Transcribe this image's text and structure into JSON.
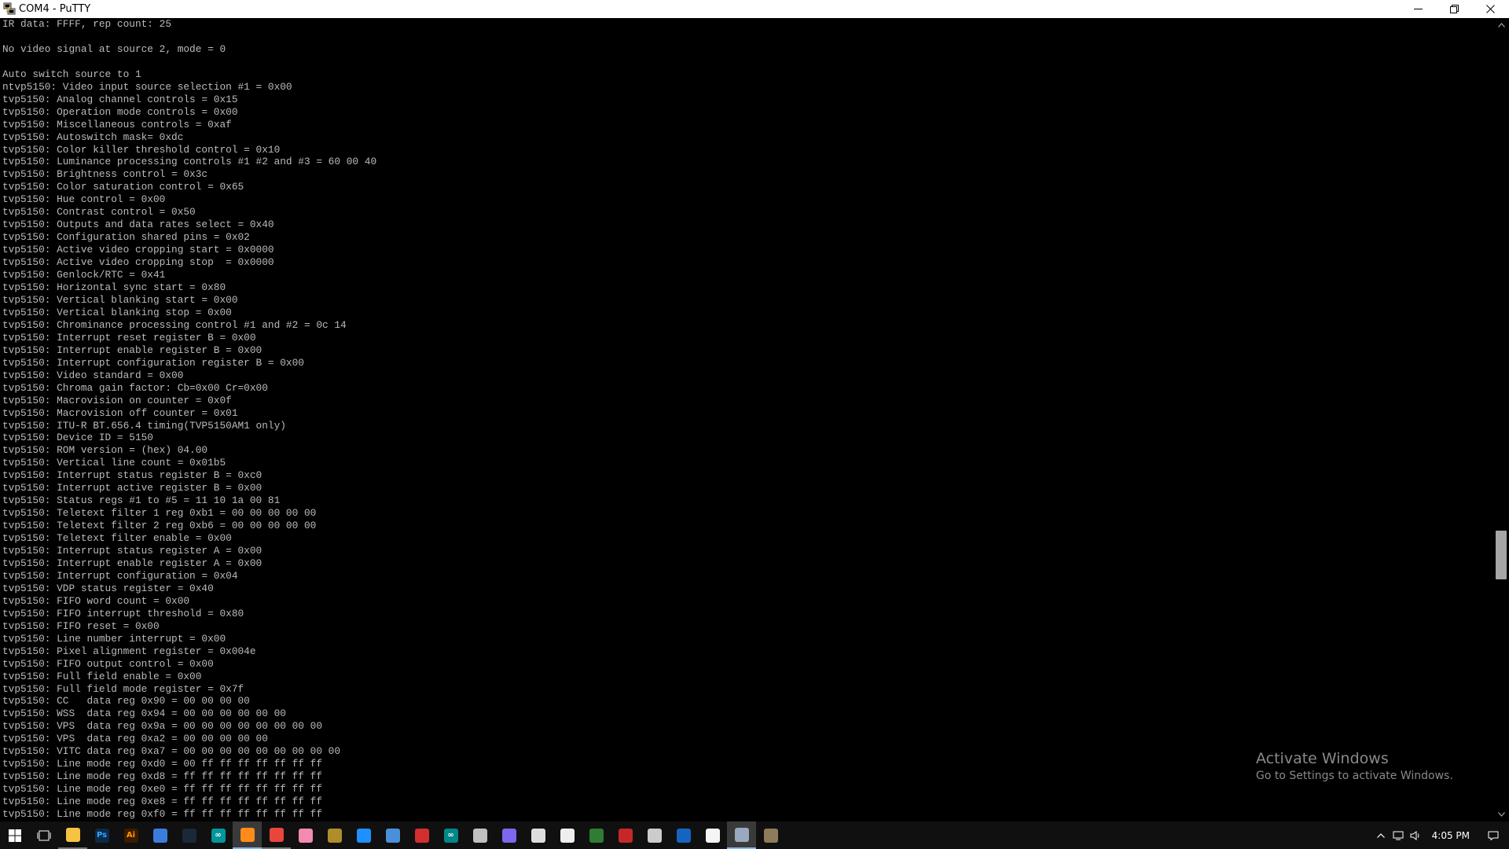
{
  "window": {
    "title": "COM4 - PuTTY"
  },
  "terminal": {
    "lines": [
      "IR data: FFFF, rep count: 25",
      "",
      "No video signal at source 2, mode = 0",
      "",
      "Auto switch source to 1",
      "ntvp5150: Video input source selection #1 = 0x00",
      "tvp5150: Analog channel controls = 0x15",
      "tvp5150: Operation mode controls = 0x00",
      "tvp5150: Miscellaneous controls = 0xaf",
      "tvp5150: Autoswitch mask= 0xdc",
      "tvp5150: Color killer threshold control = 0x10",
      "tvp5150: Luminance processing controls #1 #2 and #3 = 60 00 40",
      "tvp5150: Brightness control = 0x3c",
      "tvp5150: Color saturation control = 0x65",
      "tvp5150: Hue control = 0x00",
      "tvp5150: Contrast control = 0x50",
      "tvp5150: Outputs and data rates select = 0x40",
      "tvp5150: Configuration shared pins = 0x02",
      "tvp5150: Active video cropping start = 0x0000",
      "tvp5150: Active video cropping stop  = 0x0000",
      "tvp5150: Genlock/RTC = 0x41",
      "tvp5150: Horizontal sync start = 0x80",
      "tvp5150: Vertical blanking start = 0x00",
      "tvp5150: Vertical blanking stop = 0x00",
      "tvp5150: Chrominance processing control #1 and #2 = 0c 14",
      "tvp5150: Interrupt reset register B = 0x00",
      "tvp5150: Interrupt enable register B = 0x00",
      "tvp5150: Interrupt configuration register B = 0x00",
      "tvp5150: Video standard = 0x00",
      "tvp5150: Chroma gain factor: Cb=0x00 Cr=0x00",
      "tvp5150: Macrovision on counter = 0x0f",
      "tvp5150: Macrovision off counter = 0x01",
      "tvp5150: ITU-R BT.656.4 timing(TVP5150AM1 only)",
      "tvp5150: Device ID = 5150",
      "tvp5150: ROM version = (hex) 04.00",
      "tvp5150: Vertical line count = 0x01b5",
      "tvp5150: Interrupt status register B = 0xc0",
      "tvp5150: Interrupt active register B = 0x00",
      "tvp5150: Status regs #1 to #5 = 11 10 1a 00 81",
      "tvp5150: Teletext filter 1 reg 0xb1 = 00 00 00 00 00",
      "tvp5150: Teletext filter 2 reg 0xb6 = 00 00 00 00 00",
      "tvp5150: Teletext filter enable = 0x00",
      "tvp5150: Interrupt status register A = 0x00",
      "tvp5150: Interrupt enable register A = 0x00",
      "tvp5150: Interrupt configuration = 0x04",
      "tvp5150: VDP status register = 0x40",
      "tvp5150: FIFO word count = 0x00",
      "tvp5150: FIFO interrupt threshold = 0x80",
      "tvp5150: FIFO reset = 0x00",
      "tvp5150: Line number interrupt = 0x00",
      "tvp5150: Pixel alignment register = 0x004e",
      "tvp5150: FIFO output control = 0x00",
      "tvp5150: Full field enable = 0x00",
      "tvp5150: Full field mode register = 0x7f",
      "tvp5150: CC   data reg 0x90 = 00 00 00 00",
      "tvp5150: WSS  data reg 0x94 = 00 00 00 00 00 00",
      "tvp5150: VPS  data reg 0x9a = 00 00 00 00 00 00 00 00",
      "tvp5150: VPS  data reg 0xa2 = 00 00 00 00 00",
      "tvp5150: VITC data reg 0xa7 = 00 00 00 00 00 00 00 00 00",
      "tvp5150: Line mode reg 0xd0 = 00 ff ff ff ff ff ff ff",
      "tvp5150: Line mode reg 0xd8 = ff ff ff ff ff ff ff ff",
      "tvp5150: Line mode reg 0xe0 = ff ff ff ff ff ff ff ff",
      "tvp5150: Line mode reg 0xe8 = ff ff ff ff ff ff ff ff",
      "tvp5150: Line mode reg 0xf0 = ff ff ff ff ff ff ff ff"
    ],
    "text_color": "#bbbbbb",
    "background_color": "#000000"
  },
  "scrollbar": {
    "thumb_start": 0.643,
    "thumb_fraction": 0.063
  },
  "watermark": {
    "title": "Activate Windows",
    "subtitle": "Go to Settings to activate Windows."
  },
  "taskbar": {
    "apps": [
      {
        "icon": "windows-start-icon",
        "glyph": "",
        "color": "#ffffff",
        "state": "none"
      },
      {
        "icon": "task-view-icon",
        "glyph": "",
        "color": "#ffffff",
        "state": "none"
      },
      {
        "icon": "file-explorer-icon",
        "glyph": "",
        "color": "#f5c342",
        "state": "running"
      },
      {
        "icon": "photoshop-icon",
        "glyph": "Ps",
        "color": "#0b2a4a",
        "state": "none"
      },
      {
        "icon": "illustrator-icon",
        "glyph": "Ai",
        "color": "#3a1c00",
        "state": "none"
      },
      {
        "icon": "network-tool-icon",
        "glyph": "",
        "color": "#3b7ddd",
        "state": "none"
      },
      {
        "icon": "steam-icon",
        "glyph": "",
        "color": "#1b2838",
        "state": "none"
      },
      {
        "icon": "arduino-icon",
        "glyph": "∞",
        "color": "#00979c",
        "state": "none"
      },
      {
        "icon": "orange-app-icon",
        "glyph": "",
        "color": "#ff8c1a",
        "state": "active"
      },
      {
        "icon": "chrome-icon",
        "glyph": "",
        "color": "#e8453c",
        "state": "running"
      },
      {
        "icon": "pink-app-icon",
        "glyph": "",
        "color": "#f28ab2",
        "state": "none"
      },
      {
        "icon": "coin-app-icon",
        "glyph": "",
        "color": "#b08d2b",
        "state": "none"
      },
      {
        "icon": "maps-icon",
        "glyph": "",
        "color": "#1e90ff",
        "state": "none"
      },
      {
        "icon": "monitor-app-icon",
        "glyph": "",
        "color": "#4a90d9",
        "state": "none"
      },
      {
        "icon": "record-app-icon",
        "glyph": "",
        "color": "#d32f2f",
        "state": "none"
      },
      {
        "icon": "arduino-ide-icon",
        "glyph": "∞",
        "color": "#00878a",
        "state": "none"
      },
      {
        "icon": "stack-app-icon",
        "glyph": "",
        "color": "#c0c0c0",
        "state": "none"
      },
      {
        "icon": "vector-app-icon",
        "glyph": "",
        "color": "#7b68ee",
        "state": "none"
      },
      {
        "icon": "usb-tool-icon",
        "glyph": "",
        "color": "#dddddd",
        "state": "none"
      },
      {
        "icon": "photos-icon",
        "glyph": "",
        "color": "#eeeeee",
        "state": "none"
      },
      {
        "icon": "chip-tool-icon",
        "glyph": "",
        "color": "#2e7d32",
        "state": "none"
      },
      {
        "icon": "red-app-icon",
        "glyph": "",
        "color": "#c62828",
        "state": "none"
      },
      {
        "icon": "speaker-app-icon",
        "glyph": "",
        "color": "#cccccc",
        "state": "none"
      },
      {
        "icon": "terminal-app-icon",
        "glyph": "",
        "color": "#1565c0",
        "state": "none"
      },
      {
        "icon": "blank-app-icon",
        "glyph": "",
        "color": "#f5f5f5",
        "state": "none"
      },
      {
        "icon": "putty-icon",
        "glyph": "",
        "color": "#9aa9bf",
        "state": "active"
      },
      {
        "icon": "putty-config-icon",
        "glyph": "",
        "color": "#8d7b5a",
        "state": "none"
      }
    ],
    "clock": "4:05 PM"
  }
}
